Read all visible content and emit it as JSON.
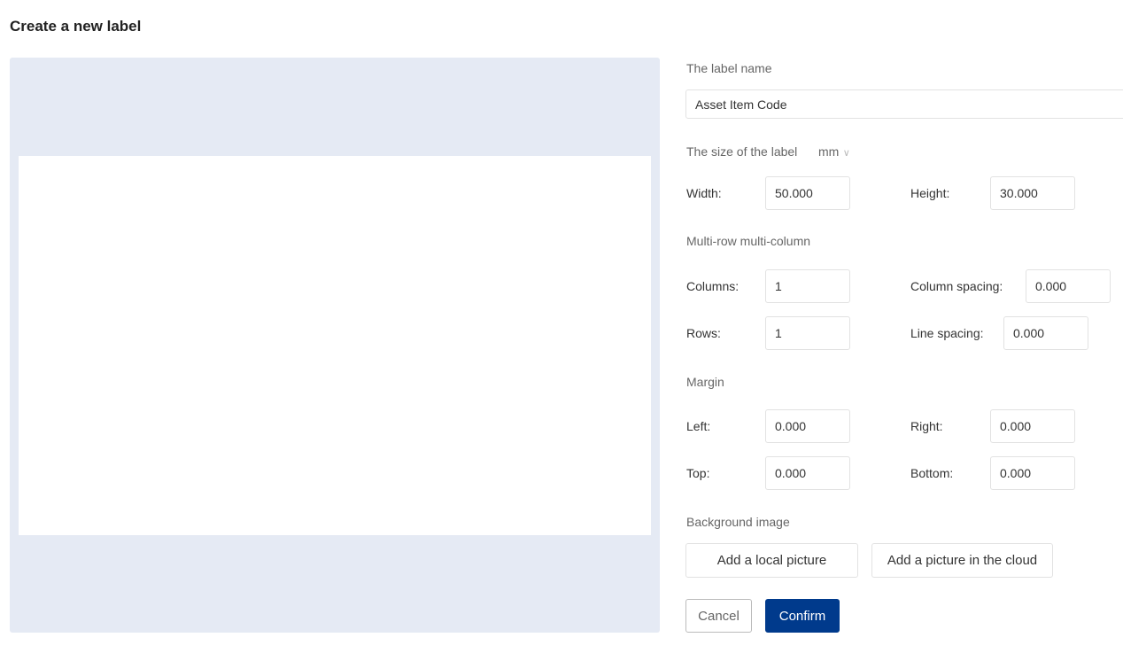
{
  "title": "Create a new label",
  "label_name": {
    "label": "The label name",
    "value": "Asset Item Code"
  },
  "size": {
    "label": "The size of the label",
    "unit": "mm",
    "width_label": "Width:",
    "width": "50.000",
    "height_label": "Height:",
    "height": "30.000"
  },
  "grid": {
    "label": "Multi-row multi-column",
    "columns_label": "Columns:",
    "columns": "1",
    "column_spacing_label": "Column spacing:",
    "column_spacing": "0.000",
    "rows_label": "Rows:",
    "rows": "1",
    "line_spacing_label": "Line spacing:",
    "line_spacing": "0.000"
  },
  "margin": {
    "label": "Margin",
    "left_label": "Left:",
    "left": "0.000",
    "right_label": "Right:",
    "right": "0.000",
    "top_label": "Top:",
    "top": "0.000",
    "bottom_label": "Bottom:",
    "bottom": "0.000"
  },
  "background": {
    "label": "Background image",
    "local": "Add a local picture",
    "cloud": "Add a picture in the cloud"
  },
  "actions": {
    "cancel": "Cancel",
    "confirm": "Confirm"
  },
  "colors": {
    "accent": "#003a8c",
    "preview_bg": "#e5eaf4"
  }
}
